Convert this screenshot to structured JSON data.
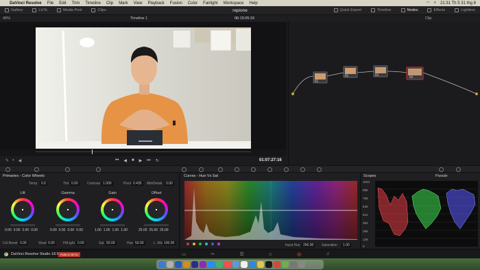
{
  "menubar": {
    "app": "DaVinci Resolve",
    "items": [
      "File",
      "Edit",
      "Trim",
      "Timeline",
      "Clip",
      "Mark",
      "View",
      "Playback",
      "Fusion",
      "Color",
      "Fairlight",
      "Workspace",
      "Help"
    ],
    "clock": "21:31 Th 5 31 thg 8"
  },
  "toolbar": {
    "left": [
      "Gallery",
      "LUTs",
      "Media Pool",
      "Clips"
    ],
    "project": "repione",
    "right": [
      "Quick Export",
      "Timeline",
      "Nodes",
      "Effects",
      "Lightbox"
    ]
  },
  "viewer": {
    "zoom": "45%",
    "timeline": "Timeline 1",
    "timecode": "06:15:05:16",
    "playhead_timecode": "01:07:27:16"
  },
  "nodes": {
    "header": "Clip",
    "items": [
      "01",
      "02",
      "03",
      "04"
    ]
  },
  "primaries": {
    "title": "Primaries - Color Wheels",
    "row1": {
      "temp_label": "Temp",
      "temp": "0.0",
      "tint_label": "Tint",
      "tint": "0.00",
      "contrast_label": "Contrast",
      "contrast": "1.000",
      "pivot_label": "Pivot",
      "pivot": "0.435",
      "middetail_label": "Mid/Detail",
      "middetail": "0.00"
    },
    "wheels": [
      {
        "label": "Lift",
        "values": [
          "0.00",
          "0.00",
          "0.00",
          "0.00"
        ]
      },
      {
        "label": "Gamma",
        "values": [
          "0.00",
          "0.00",
          "0.00",
          "0.00"
        ]
      },
      {
        "label": "Gain",
        "values": [
          "1.00",
          "1.00",
          "1.00",
          "1.00"
        ]
      },
      {
        "label": "Offset",
        "values": [
          "25.00",
          "25.00",
          "25.00"
        ]
      }
    ],
    "row3": {
      "colboost_label": "Col Boost",
      "colboost": "0.00",
      "shad_label": "Shad",
      "shad": "0.00",
      "hilight_label": "Hi/Light",
      "hilight": "0.00",
      "sat_label": "Sat",
      "sat": "50.00",
      "hue_label": "Hue",
      "hue": "50.00",
      "lmix_label": "L. Mix",
      "lmix": "100.00"
    }
  },
  "curves": {
    "title": "Curves - Hue Vs Sat",
    "input_hue_label": "Input Hue",
    "input_hue": "256.00",
    "saturation_label": "Saturation",
    "saturation": "1.00",
    "dots": [
      "#e03030",
      "#e0c030",
      "#30c030",
      "#30c0c0",
      "#4060e0",
      "#c040c0"
    ]
  },
  "scopes": {
    "title": "Scopes",
    "mode": "Parade",
    "yticks": [
      "1023",
      "896",
      "768",
      "640",
      "512",
      "384",
      "256",
      "128",
      "0"
    ]
  },
  "bottombar": {
    "app_name": "DaVinci Resolve Studio 18.5",
    "badge": "PUBLIC BETA"
  }
}
